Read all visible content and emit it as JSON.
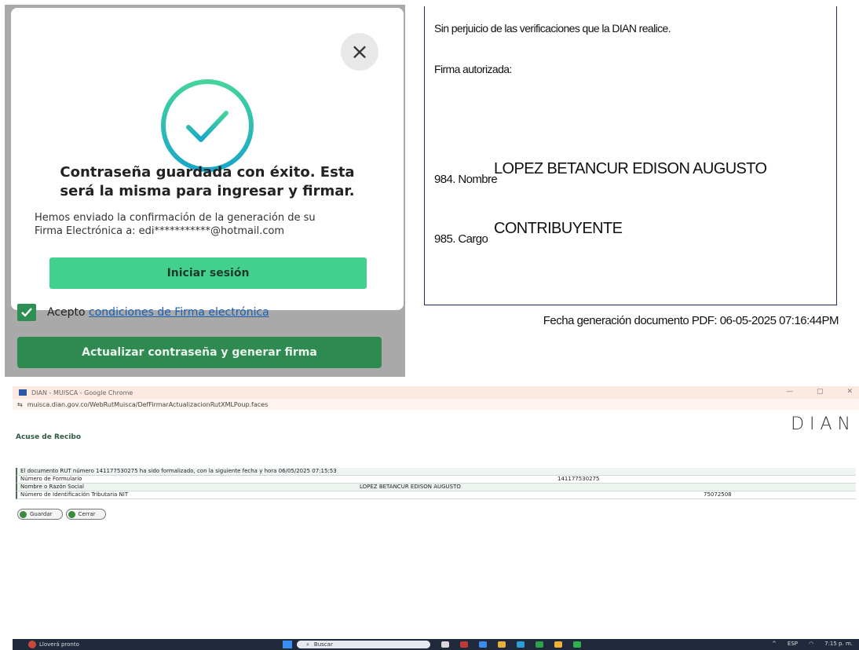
{
  "modal": {
    "close_glyph": "×",
    "title_line1": "Contraseña guardada con éxito. Esta",
    "title_line2": "será la misma para ingresar y firmar.",
    "message_line1": "Hemos enviado la confirmación de la generación de su",
    "message_line2": "Firma Electrónica a: edi***********@hotmail.com",
    "login_button": "Iniciar sesión",
    "accept_prefix": "Acepto ",
    "accept_link": "condiciones de Firma electrónica",
    "update_button": "Actualizar contraseña y generar firma",
    "colors": {
      "accent_green": "#43d08d",
      "check_gradient_start": "#45d49a",
      "check_gradient_end": "#1aa7c9",
      "dark_green": "#2f8a52"
    }
  },
  "pdf": {
    "line1": "Sin perjuicio de las verificaciones que la DIAN realice.",
    "line2": "Firma autorizada:",
    "name_label": "984. Nombre",
    "name_value": "LOPEZ BETANCUR EDISON AUGUSTO",
    "cargo_label": "985. Cargo",
    "cargo_value": "CONTRIBUYENTE",
    "footer": "Fecha generación documento PDF: 06-05-2025 07:16:44PM"
  },
  "browser": {
    "window_title": "DIAN - MUISCA - Google Chrome",
    "url": "muisca.dian.gov.co/WebRutMuisca/DefFirmarActualizacionRutXMLPoup.faces",
    "logo": "DIAN",
    "page_title": "Acuse de Recibo",
    "rows": [
      {
        "label": "El documento RUT número 141177530275 ha sido formalizado, con la siguiente fecha y hora 06/05/2025 07:15:53",
        "value": ""
      },
      {
        "label": "Número de Formulario",
        "value": "141177530275"
      },
      {
        "label": "Nombre o Razón Social",
        "value": "LOPEZ BETANCUR EDISON AUGUSTO"
      },
      {
        "label": "Número de Identificación Tributaria NIT",
        "value": "75072508"
      }
    ],
    "save_button": "Guardar",
    "close_button": "Cerrar"
  },
  "taskbar": {
    "weather_text": "Lloverá pronto",
    "search_placeholder": "Buscar",
    "language": "ESP",
    "time": "7:15 p. m."
  }
}
